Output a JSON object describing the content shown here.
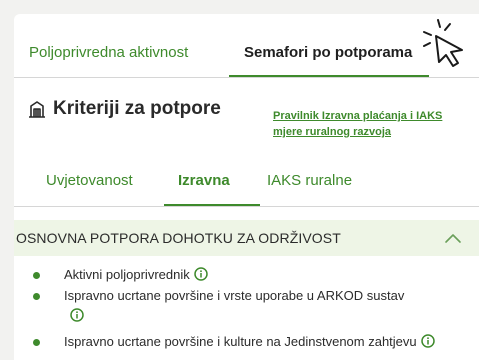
{
  "tabs": {
    "primary": [
      "Poljoprivredna aktivnost",
      "Semafori po potporama"
    ],
    "active_primary": "Semafori po potporama",
    "secondary": [
      "Uvjetovanost",
      "Izravna",
      "IAKS ruralne"
    ],
    "active_secondary": "Izravna"
  },
  "criteria": {
    "title": "Kriteriji za potpore",
    "link_line1": "Pravilnik Izravna plaćanja i IAKS",
    "link_line2": "mjere ruralnog razvoja"
  },
  "section": {
    "title": "OSNOVNA POTPORA DOHOTKU ZA ODRŽIVOST",
    "expanded": true,
    "items": [
      "Aktivni poljoprivrednik",
      "Ispravno ucrtane površine i vrste uporabe u ARKOD sustav",
      "Ispravno ucrtane površine i kulture na Jedinstvenom zahtjevu"
    ]
  },
  "colors": {
    "accent": "#3e8a2c",
    "section_bg": "#eef5e6"
  },
  "icons": [
    "cursor-click-icon",
    "building-icon",
    "chevron-up-icon",
    "info-icon"
  ]
}
